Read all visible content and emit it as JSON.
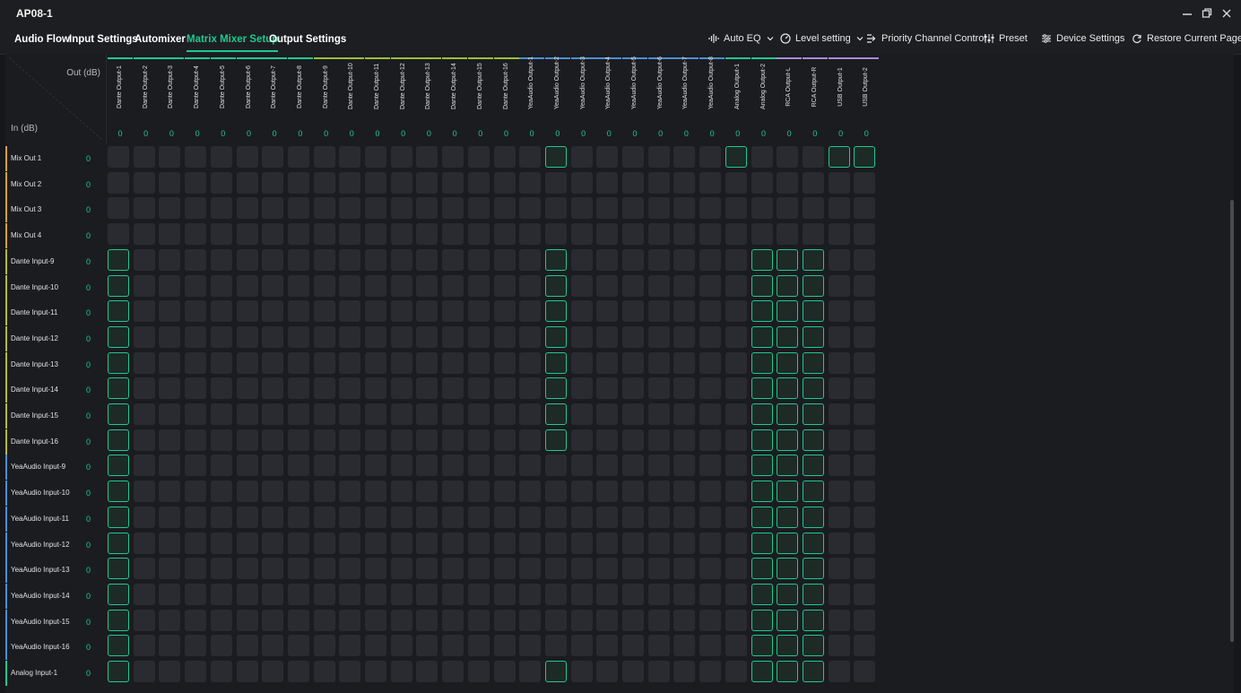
{
  "app": {
    "title": "AP08-1"
  },
  "window": {
    "minimize_label": "–",
    "restore_label": "⧉",
    "close_label": "✕"
  },
  "nav": {
    "tabs": [
      {
        "label": "Audio Flow",
        "active": false
      },
      {
        "label": "Input Settings",
        "active": false
      },
      {
        "label": "Automixer",
        "active": false
      },
      {
        "label": "Matrix Mixer Setup",
        "active": true
      },
      {
        "label": "Output Settings",
        "active": false
      }
    ],
    "tools": {
      "auto_eq": "Auto EQ",
      "level_setting": "Level setting",
      "priority": "Priority Channel Control",
      "preset": "Preset",
      "device_settings": "Device Settings",
      "restore": "Restore Current Page"
    }
  },
  "matrix": {
    "out_label": "Out (dB)",
    "in_label": "In (dB)",
    "colors": {
      "accent": "#1fc88e",
      "group_dante_out": "#1fc88e",
      "group_dante_out_b": "#9bbf3a",
      "group_yea_out": "#4a8fd6",
      "group_analog_out": "#1fc88e",
      "group_rca_out": "#a88ad6",
      "group_usb_out": "#a88ad6",
      "row_mix": "#d6a13a",
      "row_dante": "#b5b83a",
      "row_yea": "#4a8fd6",
      "row_analog": "#1fc88e"
    },
    "columns": [
      {
        "label": "Dante Output-1",
        "value": "0"
      },
      {
        "label": "Dante Output-2",
        "value": "0"
      },
      {
        "label": "Dante Output-3",
        "value": "0"
      },
      {
        "label": "Dante Output-4",
        "value": "0"
      },
      {
        "label": "Dante Output-5",
        "value": "0"
      },
      {
        "label": "Dante Output-6",
        "value": "0"
      },
      {
        "label": "Dante Output-7",
        "value": "0"
      },
      {
        "label": "Dante Output-8",
        "value": "0"
      },
      {
        "label": "Dante Output-9",
        "value": "0"
      },
      {
        "label": "Dante Output-10",
        "value": "0"
      },
      {
        "label": "Dante Output-11",
        "value": "0"
      },
      {
        "label": "Dante Output-12",
        "value": "0"
      },
      {
        "label": "Dante Output-13",
        "value": "0"
      },
      {
        "label": "Dante Output-14",
        "value": "0"
      },
      {
        "label": "Dante Output-15",
        "value": "0"
      },
      {
        "label": "Dante Output-16",
        "value": "0"
      },
      {
        "label": "YeaAudio Output-1",
        "value": "0"
      },
      {
        "label": "YeaAudio Output-2",
        "value": "0"
      },
      {
        "label": "YeaAudio Output-3",
        "value": "0"
      },
      {
        "label": "YeaAudio Output-4",
        "value": "0"
      },
      {
        "label": "YeaAudio Output-5",
        "value": "0"
      },
      {
        "label": "YeaAudio Output-6",
        "value": "0"
      },
      {
        "label": "YeaAudio Output-7",
        "value": "0"
      },
      {
        "label": "YeaAudio Output-8",
        "value": "0"
      },
      {
        "label": "Analog Output-1",
        "value": "0"
      },
      {
        "label": "Analog Output-2",
        "value": "0"
      },
      {
        "label": "RCA Output-L",
        "value": "0"
      },
      {
        "label": "RCA Output-R",
        "value": "0"
      },
      {
        "label": "USB Output-1",
        "value": "0"
      },
      {
        "label": "USB Output-2",
        "value": "0"
      }
    ],
    "rows": [
      {
        "label": "Mix Out 1",
        "value": "0",
        "active": [
          17,
          24,
          28,
          29
        ]
      },
      {
        "label": "Mix Out 2",
        "value": "0",
        "active": []
      },
      {
        "label": "Mix Out 3",
        "value": "0",
        "active": []
      },
      {
        "label": "Mix Out 4",
        "value": "0",
        "active": []
      },
      {
        "label": "Dante Input-9",
        "value": "0",
        "active": [
          0,
          17,
          25,
          26,
          27
        ]
      },
      {
        "label": "Dante Input-10",
        "value": "0",
        "active": [
          0,
          17,
          25,
          26,
          27
        ]
      },
      {
        "label": "Dante Input-11",
        "value": "0",
        "active": [
          0,
          17,
          25,
          26,
          27
        ]
      },
      {
        "label": "Dante Input-12",
        "value": "0",
        "active": [
          0,
          17,
          25,
          26,
          27
        ]
      },
      {
        "label": "Dante Input-13",
        "value": "0",
        "active": [
          0,
          17,
          25,
          26,
          27
        ]
      },
      {
        "label": "Dante Input-14",
        "value": "0",
        "active": [
          0,
          17,
          25,
          26,
          27
        ]
      },
      {
        "label": "Dante Input-15",
        "value": "0",
        "active": [
          0,
          17,
          25,
          26,
          27
        ]
      },
      {
        "label": "Dante Input-16",
        "value": "0",
        "active": [
          0,
          17,
          25,
          26,
          27
        ]
      },
      {
        "label": "YeaAudio Input-9",
        "value": "0",
        "active": [
          0,
          25,
          26,
          27
        ]
      },
      {
        "label": "YeaAudio Input-10",
        "value": "0",
        "active": [
          0,
          25,
          26,
          27
        ]
      },
      {
        "label": "YeaAudio Input-11",
        "value": "0",
        "active": [
          0,
          25,
          26,
          27
        ]
      },
      {
        "label": "YeaAudio Input-12",
        "value": "0",
        "active": [
          0,
          25,
          26,
          27
        ]
      },
      {
        "label": "YeaAudio Input-13",
        "value": "0",
        "active": [
          0,
          25,
          26,
          27
        ]
      },
      {
        "label": "YeaAudio Input-14",
        "value": "0",
        "active": [
          0,
          25,
          26,
          27
        ]
      },
      {
        "label": "YeaAudio Input-15",
        "value": "0",
        "active": [
          0,
          25,
          26,
          27
        ]
      },
      {
        "label": "YeaAudio Input-16",
        "value": "0",
        "active": [
          0,
          25,
          26,
          27
        ]
      },
      {
        "label": "Analog Input-1",
        "value": "0",
        "active": [
          0,
          17,
          25,
          26,
          27
        ]
      }
    ]
  }
}
